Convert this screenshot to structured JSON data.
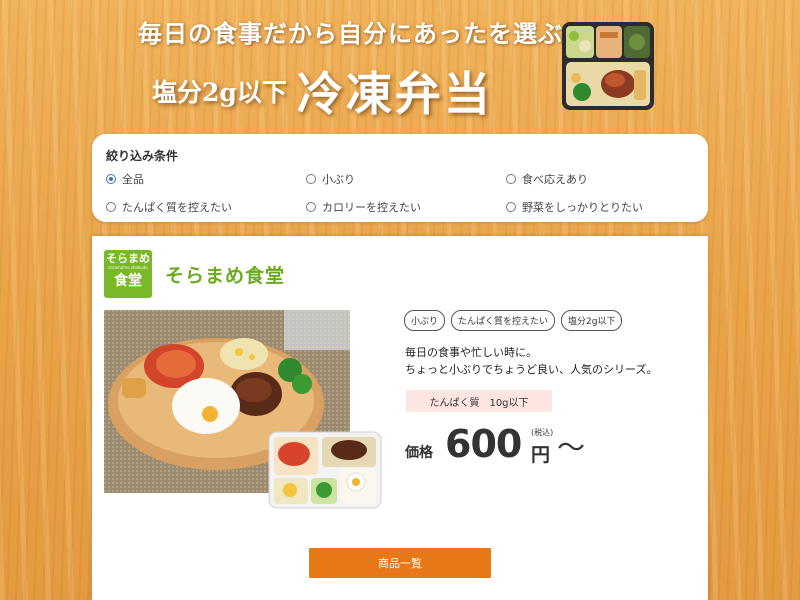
{
  "banner": {
    "line1": "毎日の食事だから自分にあったを選ぶ",
    "salt": "塩分2g以下",
    "main": "冷凍弁当"
  },
  "filter": {
    "title": "絞り込み条件",
    "options": [
      {
        "label": "全品",
        "checked": true
      },
      {
        "label": "小ぶり",
        "checked": false
      },
      {
        "label": "食べ応えあり",
        "checked": false
      },
      {
        "label": "たんぱく質を控えたい",
        "checked": false
      },
      {
        "label": "カロリーを控えたい",
        "checked": false
      },
      {
        "label": "野菜をしっかりとりたい",
        "checked": false
      }
    ]
  },
  "product": {
    "logo_top": "そらまめ",
    "logo_roman": "soramame shokudo",
    "logo_bottom": "食堂",
    "brand_name": "そらまめ食堂",
    "tags": [
      "小ぶり",
      "たんぱく質を控えたい",
      "塩分2g以下"
    ],
    "desc_line1": "毎日の食事や忙しい時に。",
    "desc_line2": "ちょっと小ぶりでちょうど良い、人気のシリーズ。",
    "protein": "たんぱく質　10g以下",
    "price_label": "価格",
    "price_value": "600",
    "price_unit": "円",
    "price_tax": "(税込)",
    "price_tilde": "〜"
  },
  "button": {
    "label": "商品一覧"
  },
  "colors": {
    "brand_green": "#6aab1f",
    "button_orange": "#e67817",
    "protein_bg": "#fde6e2",
    "radio_blue": "#3a72c4"
  }
}
